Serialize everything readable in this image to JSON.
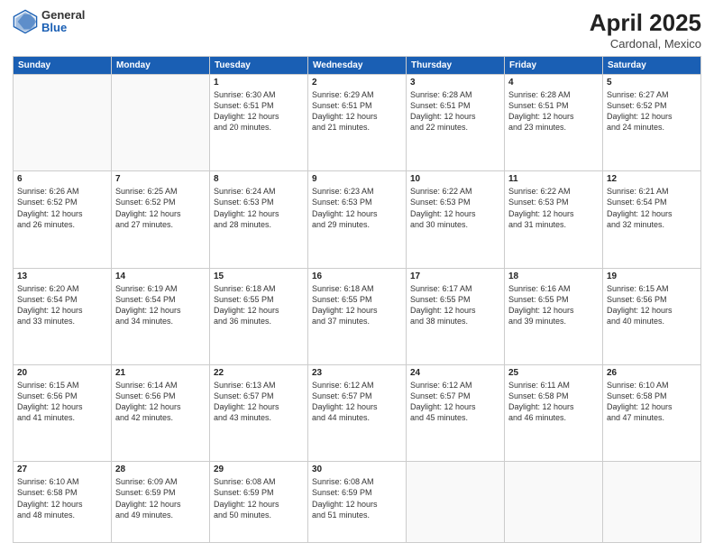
{
  "header": {
    "logo_general": "General",
    "logo_blue": "Blue",
    "month_title": "April 2025",
    "location": "Cardonal, Mexico"
  },
  "days_of_week": [
    "Sunday",
    "Monday",
    "Tuesday",
    "Wednesday",
    "Thursday",
    "Friday",
    "Saturday"
  ],
  "weeks": [
    [
      {
        "day": "",
        "info": ""
      },
      {
        "day": "",
        "info": ""
      },
      {
        "day": "1",
        "info": "Sunrise: 6:30 AM\nSunset: 6:51 PM\nDaylight: 12 hours\nand 20 minutes."
      },
      {
        "day": "2",
        "info": "Sunrise: 6:29 AM\nSunset: 6:51 PM\nDaylight: 12 hours\nand 21 minutes."
      },
      {
        "day": "3",
        "info": "Sunrise: 6:28 AM\nSunset: 6:51 PM\nDaylight: 12 hours\nand 22 minutes."
      },
      {
        "day": "4",
        "info": "Sunrise: 6:28 AM\nSunset: 6:51 PM\nDaylight: 12 hours\nand 23 minutes."
      },
      {
        "day": "5",
        "info": "Sunrise: 6:27 AM\nSunset: 6:52 PM\nDaylight: 12 hours\nand 24 minutes."
      }
    ],
    [
      {
        "day": "6",
        "info": "Sunrise: 6:26 AM\nSunset: 6:52 PM\nDaylight: 12 hours\nand 26 minutes."
      },
      {
        "day": "7",
        "info": "Sunrise: 6:25 AM\nSunset: 6:52 PM\nDaylight: 12 hours\nand 27 minutes."
      },
      {
        "day": "8",
        "info": "Sunrise: 6:24 AM\nSunset: 6:53 PM\nDaylight: 12 hours\nand 28 minutes."
      },
      {
        "day": "9",
        "info": "Sunrise: 6:23 AM\nSunset: 6:53 PM\nDaylight: 12 hours\nand 29 minutes."
      },
      {
        "day": "10",
        "info": "Sunrise: 6:22 AM\nSunset: 6:53 PM\nDaylight: 12 hours\nand 30 minutes."
      },
      {
        "day": "11",
        "info": "Sunrise: 6:22 AM\nSunset: 6:53 PM\nDaylight: 12 hours\nand 31 minutes."
      },
      {
        "day": "12",
        "info": "Sunrise: 6:21 AM\nSunset: 6:54 PM\nDaylight: 12 hours\nand 32 minutes."
      }
    ],
    [
      {
        "day": "13",
        "info": "Sunrise: 6:20 AM\nSunset: 6:54 PM\nDaylight: 12 hours\nand 33 minutes."
      },
      {
        "day": "14",
        "info": "Sunrise: 6:19 AM\nSunset: 6:54 PM\nDaylight: 12 hours\nand 34 minutes."
      },
      {
        "day": "15",
        "info": "Sunrise: 6:18 AM\nSunset: 6:55 PM\nDaylight: 12 hours\nand 36 minutes."
      },
      {
        "day": "16",
        "info": "Sunrise: 6:18 AM\nSunset: 6:55 PM\nDaylight: 12 hours\nand 37 minutes."
      },
      {
        "day": "17",
        "info": "Sunrise: 6:17 AM\nSunset: 6:55 PM\nDaylight: 12 hours\nand 38 minutes."
      },
      {
        "day": "18",
        "info": "Sunrise: 6:16 AM\nSunset: 6:55 PM\nDaylight: 12 hours\nand 39 minutes."
      },
      {
        "day": "19",
        "info": "Sunrise: 6:15 AM\nSunset: 6:56 PM\nDaylight: 12 hours\nand 40 minutes."
      }
    ],
    [
      {
        "day": "20",
        "info": "Sunrise: 6:15 AM\nSunset: 6:56 PM\nDaylight: 12 hours\nand 41 minutes."
      },
      {
        "day": "21",
        "info": "Sunrise: 6:14 AM\nSunset: 6:56 PM\nDaylight: 12 hours\nand 42 minutes."
      },
      {
        "day": "22",
        "info": "Sunrise: 6:13 AM\nSunset: 6:57 PM\nDaylight: 12 hours\nand 43 minutes."
      },
      {
        "day": "23",
        "info": "Sunrise: 6:12 AM\nSunset: 6:57 PM\nDaylight: 12 hours\nand 44 minutes."
      },
      {
        "day": "24",
        "info": "Sunrise: 6:12 AM\nSunset: 6:57 PM\nDaylight: 12 hours\nand 45 minutes."
      },
      {
        "day": "25",
        "info": "Sunrise: 6:11 AM\nSunset: 6:58 PM\nDaylight: 12 hours\nand 46 minutes."
      },
      {
        "day": "26",
        "info": "Sunrise: 6:10 AM\nSunset: 6:58 PM\nDaylight: 12 hours\nand 47 minutes."
      }
    ],
    [
      {
        "day": "27",
        "info": "Sunrise: 6:10 AM\nSunset: 6:58 PM\nDaylight: 12 hours\nand 48 minutes."
      },
      {
        "day": "28",
        "info": "Sunrise: 6:09 AM\nSunset: 6:59 PM\nDaylight: 12 hours\nand 49 minutes."
      },
      {
        "day": "29",
        "info": "Sunrise: 6:08 AM\nSunset: 6:59 PM\nDaylight: 12 hours\nand 50 minutes."
      },
      {
        "day": "30",
        "info": "Sunrise: 6:08 AM\nSunset: 6:59 PM\nDaylight: 12 hours\nand 51 minutes."
      },
      {
        "day": "",
        "info": ""
      },
      {
        "day": "",
        "info": ""
      },
      {
        "day": "",
        "info": ""
      }
    ]
  ]
}
